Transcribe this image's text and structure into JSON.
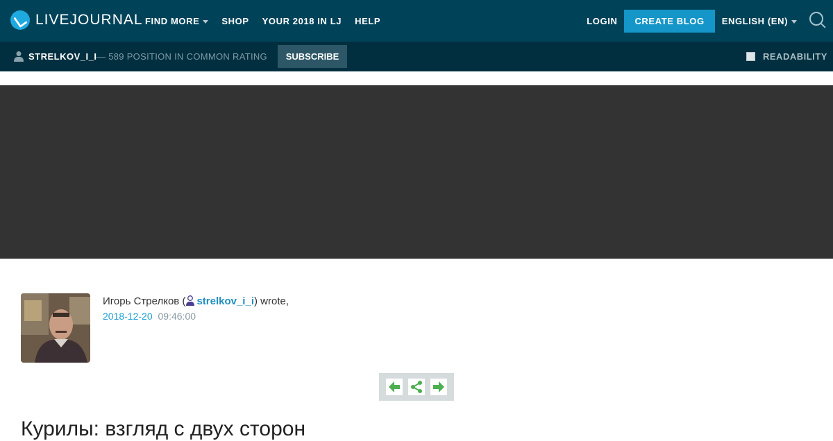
{
  "header": {
    "logo_text": "LIVEJOURNAL",
    "nav": [
      {
        "label": "FIND MORE",
        "has_dropdown": true
      },
      {
        "label": "SHOP",
        "has_dropdown": false
      },
      {
        "label": "YOUR 2018 IN LJ",
        "has_dropdown": false
      },
      {
        "label": "HELP",
        "has_dropdown": false
      }
    ],
    "login_label": "LOGIN",
    "create_blog_label": "CREATE BLOG",
    "language_label": "ENGLISH (EN)",
    "search_icon": "search-icon"
  },
  "journal_bar": {
    "username": "STRELKOV_I_I",
    "rating_text": "— 589 POSITION IN COMMON RATING",
    "subscribe_label": "SUBSCRIBE",
    "readability_label": "READABILITY",
    "readability_checked": false
  },
  "post": {
    "author_name": "Игорь Стрелков (",
    "lj_user": "strelkov_i_i",
    "wrote_suffix": ") wrote,",
    "date": "2018-12-20",
    "time": "09:46:00",
    "title": "Курилы: взгляд с двух сторон",
    "controls": [
      "arrow-left-icon",
      "share-icon",
      "arrow-right-icon"
    ]
  },
  "colors": {
    "header_bg": "#004359",
    "subbar_bg": "#012f3f",
    "accent": "#1596c8",
    "banner_bg": "#333333",
    "control_green": "#4caf50"
  }
}
